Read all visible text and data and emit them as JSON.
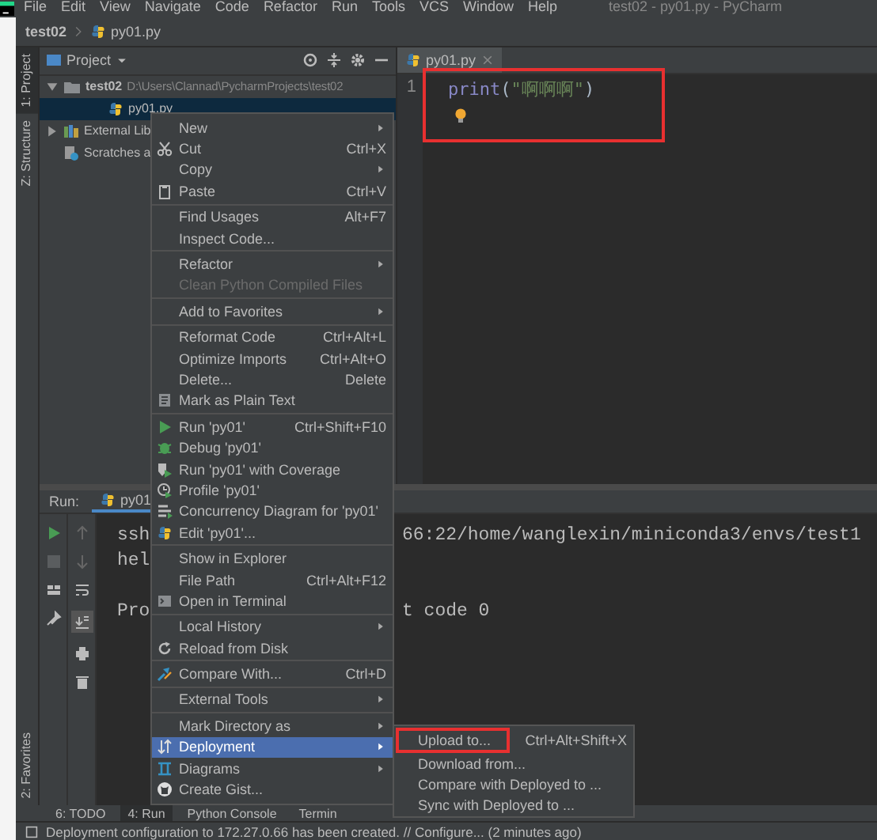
{
  "menu_bar": {
    "items": [
      "File",
      "Edit",
      "View",
      "Navigate",
      "Code",
      "Refactor",
      "Run",
      "Tools",
      "VCS",
      "Window",
      "Help"
    ],
    "title": "test02 - py01.py - PyCharm"
  },
  "breadcrumb": [
    "test02",
    "py01.py"
  ],
  "tool_strip": {
    "top": [
      {
        "label": "1: Project",
        "selected": true
      },
      {
        "label": "Z: Structure",
        "selected": false
      }
    ],
    "bottom": [
      {
        "label": "2: Favorites",
        "selected": false
      }
    ]
  },
  "project_panel": {
    "title": "Project",
    "tree": [
      {
        "kind": "folder",
        "name": "test02",
        "path": "D:\\Users\\Clannad\\PycharmProjects\\test02",
        "expanded": true,
        "selected": false,
        "children": [
          {
            "kind": "file",
            "name": "py01.py",
            "selected": true
          }
        ]
      },
      {
        "kind": "library",
        "name": "External Lib",
        "expanded": false,
        "selected": false
      },
      {
        "kind": "scratches",
        "name": "Scratches a",
        "selected": false
      }
    ]
  },
  "editor": {
    "outlined": true,
    "tabs": [
      {
        "label": "py01.py",
        "selected": true
      }
    ],
    "lines": [
      {
        "number": "1",
        "code": [
          {
            "kind": "builtin",
            "text": "print"
          },
          {
            "kind": "punct",
            "text": "("
          },
          {
            "kind": "string",
            "text": "\"啊啊啊\""
          },
          {
            "kind": "punct",
            "text": ")"
          }
        ]
      }
    ]
  },
  "run_panel": {
    "label": "Run:",
    "tabs": [
      {
        "label": "py01",
        "selected": true
      }
    ],
    "output": [
      {
        "kind": "text",
        "left": "ssh",
        "right": "66:22/home/wanglexin/miniconda3/envs/test1"
      },
      {
        "kind": "text",
        "left": "hel"
      },
      {
        "kind": "blank"
      },
      {
        "kind": "text",
        "left": "Pro",
        "right": "t code 0"
      }
    ]
  },
  "context_menu": {
    "items": [
      {
        "label": "New",
        "has_submenu": true,
        "disabled": false,
        "selected": false
      },
      {
        "label": "Cut",
        "shortcut": "Ctrl+X",
        "has_submenu": false,
        "disabled": false,
        "selected": false
      },
      {
        "label": "Copy",
        "has_submenu": true,
        "disabled": false,
        "selected": false
      },
      {
        "label": "Paste",
        "shortcut": "Ctrl+V",
        "has_submenu": false,
        "disabled": false,
        "selected": false
      },
      {
        "kind": "separator"
      },
      {
        "label": "Find Usages",
        "shortcut": "Alt+F7",
        "has_submenu": false,
        "disabled": false,
        "selected": false
      },
      {
        "label": "Inspect Code...",
        "has_submenu": false,
        "disabled": false,
        "selected": false
      },
      {
        "kind": "separator"
      },
      {
        "label": "Refactor",
        "has_submenu": true,
        "disabled": false,
        "selected": false
      },
      {
        "label": "Clean Python Compiled Files",
        "has_submenu": false,
        "disabled": true,
        "selected": false
      },
      {
        "kind": "separator"
      },
      {
        "label": "Add to Favorites",
        "has_submenu": true,
        "disabled": false,
        "selected": false
      },
      {
        "kind": "separator"
      },
      {
        "label": "Reformat Code",
        "shortcut": "Ctrl+Alt+L",
        "has_submenu": false,
        "disabled": false,
        "selected": false
      },
      {
        "label": "Optimize Imports",
        "shortcut": "Ctrl+Alt+O",
        "has_submenu": false,
        "disabled": false,
        "selected": false
      },
      {
        "label": "Delete...",
        "shortcut": "Delete",
        "has_submenu": false,
        "disabled": false,
        "selected": false
      },
      {
        "label": "Mark as Plain Text",
        "has_submenu": false,
        "disabled": false,
        "selected": false
      },
      {
        "kind": "separator"
      },
      {
        "label": "Run 'py01'",
        "shortcut": "Ctrl+Shift+F10",
        "has_submenu": false,
        "disabled": false,
        "selected": false
      },
      {
        "label": "Debug 'py01'",
        "has_submenu": false,
        "disabled": false,
        "selected": false
      },
      {
        "label": "Run 'py01' with Coverage",
        "has_submenu": false,
        "disabled": false,
        "selected": false
      },
      {
        "label": "Profile 'py01'",
        "has_submenu": false,
        "disabled": false,
        "selected": false
      },
      {
        "label": "Concurrency Diagram for 'py01'",
        "has_submenu": false,
        "disabled": false,
        "selected": false
      },
      {
        "label": "Edit 'py01'...",
        "has_submenu": false,
        "disabled": false,
        "selected": false
      },
      {
        "kind": "separator"
      },
      {
        "label": "Show in Explorer",
        "has_submenu": false,
        "disabled": false,
        "selected": false
      },
      {
        "label": "File Path",
        "shortcut": "Ctrl+Alt+F12",
        "has_submenu": false,
        "disabled": false,
        "selected": false
      },
      {
        "label": "Open in Terminal",
        "has_submenu": false,
        "disabled": false,
        "selected": false
      },
      {
        "kind": "separator"
      },
      {
        "label": "Local History",
        "has_submenu": true,
        "disabled": false,
        "selected": false
      },
      {
        "label": "Reload from Disk",
        "has_submenu": false,
        "disabled": false,
        "selected": false
      },
      {
        "kind": "separator"
      },
      {
        "label": "Compare With...",
        "shortcut": "Ctrl+D",
        "has_submenu": false,
        "disabled": false,
        "selected": false
      },
      {
        "kind": "separator"
      },
      {
        "label": "External Tools",
        "has_submenu": true,
        "disabled": false,
        "selected": false
      },
      {
        "kind": "separator"
      },
      {
        "label": "Mark Directory as",
        "has_submenu": true,
        "disabled": false,
        "selected": false
      },
      {
        "label": "Deployment",
        "has_submenu": true,
        "disabled": false,
        "selected": true
      },
      {
        "label": "Diagrams",
        "has_submenu": true,
        "disabled": false,
        "selected": false
      },
      {
        "label": "Create Gist...",
        "has_submenu": false,
        "disabled": false,
        "selected": false
      }
    ]
  },
  "submenu": {
    "items": [
      {
        "label": "Upload to...",
        "shortcut": "Ctrl+Alt+Shift+X",
        "selected": false,
        "outlined": true
      },
      {
        "label": "Download from...",
        "selected": false,
        "outlined": false
      },
      {
        "label": "Compare with Deployed to ...",
        "selected": false,
        "outlined": false
      },
      {
        "label": "Sync with Deployed to ...",
        "selected": false,
        "outlined": false
      }
    ]
  },
  "bottom_tabs": [
    {
      "label": "6: TODO",
      "selected": false
    },
    {
      "label": "4: Run",
      "selected": true
    },
    {
      "label": "Python Console",
      "selected": false
    },
    {
      "label": "Termin",
      "selected": false
    }
  ],
  "status_bar": {
    "message": "Deployment configuration to 172.27.0.66 has been created. // Configure... (2 minutes ago)"
  }
}
